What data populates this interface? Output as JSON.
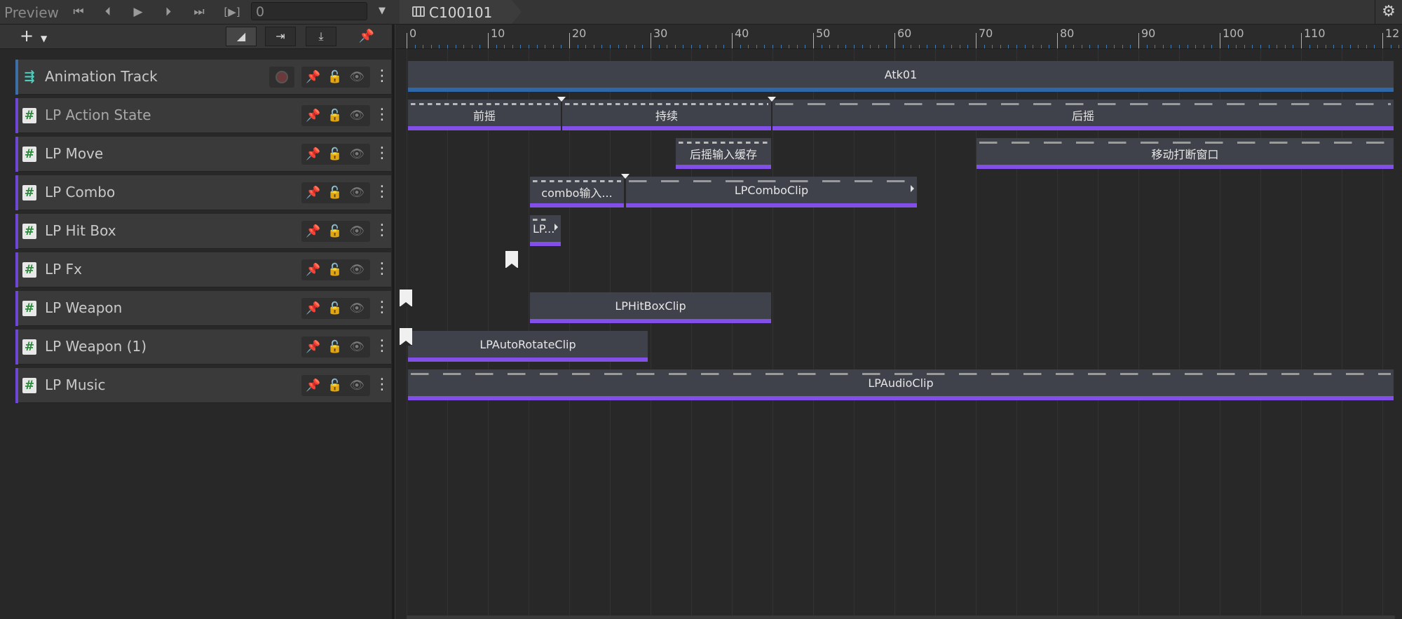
{
  "toolbar": {
    "preview_label": "Preview",
    "frame_value": "0",
    "timeline_asset": "C100101",
    "controls": {
      "first": "⏮",
      "prev": "⏴",
      "play": "▶",
      "next": "⏵",
      "last": "⏭",
      "range": "[▶]"
    }
  },
  "toolbar2": {
    "add": "+",
    "add_caret": "▼",
    "snap_tool": "◢",
    "ripple_tool": "⇥",
    "fit_tool": "⤓",
    "pin_tool": "📌"
  },
  "ruler": {
    "labels": [
      "0",
      "10",
      "20",
      "30",
      "40",
      "50",
      "60",
      "70",
      "80",
      "90",
      "100",
      "110",
      "12"
    ]
  },
  "tracks": [
    {
      "name": "Animation Track",
      "type": "animation"
    },
    {
      "name": "LP Action State",
      "type": "script"
    },
    {
      "name": "LP Move",
      "type": "script"
    },
    {
      "name": "LP Combo",
      "type": "script"
    },
    {
      "name": "LP Hit Box",
      "type": "script"
    },
    {
      "name": "LP Fx",
      "type": "script"
    },
    {
      "name": "LP Weapon",
      "type": "script"
    },
    {
      "name": "LP Weapon (1)",
      "type": "script"
    },
    {
      "name": "LP Music",
      "type": "script"
    }
  ],
  "clips": {
    "atk01": "Atk01",
    "qianyao": "前摇",
    "chixu": "持续",
    "houyao": "后摇",
    "houyao_buffer": "后摇输入缓存",
    "move_break": "移动打断窗口",
    "combo_input": "combo输入...",
    "combo_clip": "LPComboClip",
    "hitbox_small": "LP...",
    "weapon_hitbox": "LPHitBoxClip",
    "auto_rotate": "LPAutoRotateClip",
    "audio": "LPAudioClip"
  },
  "icons": {
    "track_script": "#",
    "track_anim": "⇶",
    "pin": "📌",
    "lock": "🔓",
    "eye": "👁",
    "kebab": "⋮",
    "gear": "⚙"
  }
}
